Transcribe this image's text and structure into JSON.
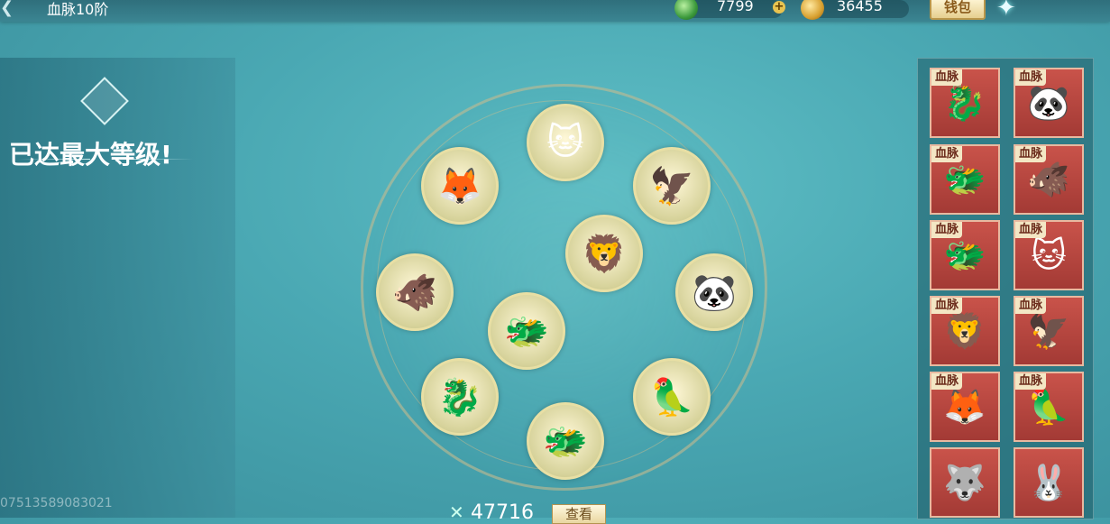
{
  "header": {
    "back_icon": "chevron-left-icon",
    "title": "血脉10阶",
    "resources": [
      {
        "icon": "jade-icon",
        "value": "7799"
      },
      {
        "icon": "gold-ingot-icon",
        "value": "36455"
      }
    ],
    "plus_label": "+",
    "wallet_label": "钱包",
    "menu_icon": "star-menu-icon"
  },
  "left_panel": {
    "emblem_icon": "bloodline-emblem-icon",
    "status_text": "已达最大等级!",
    "player_id": "07513589083021"
  },
  "wheel": {
    "nodes": [
      {
        "name": "white-cat",
        "glyph": "🐱"
      },
      {
        "name": "ice-phoenix",
        "glyph": "🦅"
      },
      {
        "name": "panda",
        "glyph": "🐼"
      },
      {
        "name": "fire-bird",
        "glyph": "🦜"
      },
      {
        "name": "azure-dragon",
        "glyph": "🐲"
      },
      {
        "name": "fire-dragon",
        "glyph": "🐉"
      },
      {
        "name": "dark-boar",
        "glyph": "🐗"
      },
      {
        "name": "red-fox",
        "glyph": "🦊"
      },
      {
        "name": "lion-dance",
        "glyph": "🦁"
      },
      {
        "name": "brown-dragon",
        "glyph": "🐲"
      }
    ],
    "cost_icon": "cross-token-icon",
    "cost_value": "47716",
    "view_label": "查看"
  },
  "collection": {
    "tag_label": "血脉",
    "cards": [
      {
        "name": "fire-dragon",
        "glyph": "🐉",
        "tagged": true
      },
      {
        "name": "panda",
        "glyph": "🐼",
        "tagged": true
      },
      {
        "name": "brown-dragon",
        "glyph": "🐲",
        "tagged": true
      },
      {
        "name": "dark-boar",
        "glyph": "🐗",
        "tagged": true
      },
      {
        "name": "azure-dragon",
        "glyph": "🐲",
        "tagged": true
      },
      {
        "name": "white-cat",
        "glyph": "🐱",
        "tagged": true
      },
      {
        "name": "lion-dance",
        "glyph": "🦁",
        "tagged": true
      },
      {
        "name": "ice-phoenix",
        "glyph": "🦅",
        "tagged": true
      },
      {
        "name": "red-fox",
        "glyph": "🦊",
        "tagged": true
      },
      {
        "name": "fire-bird",
        "glyph": "🦜",
        "tagged": true
      },
      {
        "name": "frost-wolf",
        "glyph": "🐺",
        "tagged": false
      },
      {
        "name": "snow-rabbit",
        "glyph": "🐰",
        "tagged": false
      }
    ]
  }
}
